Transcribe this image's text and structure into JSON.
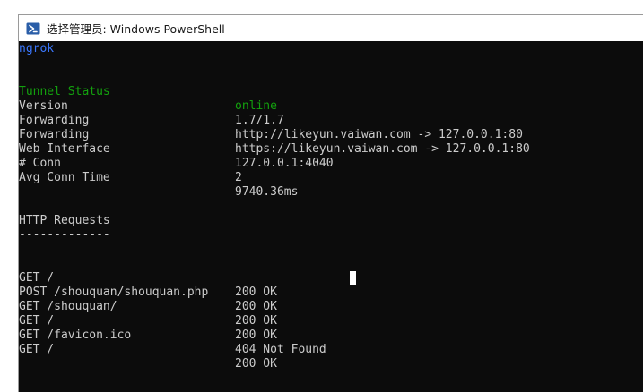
{
  "window": {
    "title": "选择管理员: Windows PowerShell",
    "icon": "powershell-icon"
  },
  "console": {
    "brand": "ngrok",
    "status": [
      {
        "label": "Tunnel Status",
        "value": "online"
      },
      {
        "label": "Version",
        "value": "1.7/1.7"
      },
      {
        "label": "Forwarding",
        "value": "http://likeyun.vaiwan.com -> 127.0.0.1:80"
      },
      {
        "label": "Forwarding",
        "value": "https://likeyun.vaiwan.com -> 127.0.0.1:80"
      },
      {
        "label": "Web Interface",
        "value": "127.0.0.1:4040"
      },
      {
        "label": "# Conn",
        "value": "2"
      },
      {
        "label": "Avg Conn Time",
        "value": "9740.36ms"
      }
    ],
    "requests_heading": "HTTP Requests",
    "requests_divider": "-------------",
    "requests": [
      {
        "request": "GET /",
        "status": "200 OK"
      },
      {
        "request": "POST /shouquan/shouquan.php",
        "status": "200 OK"
      },
      {
        "request": "GET /shouquan/",
        "status": "200 OK"
      },
      {
        "request": "GET /",
        "status": "200 OK"
      },
      {
        "request": "GET /favicon.ico",
        "status": "404 Not Found"
      },
      {
        "request": "GET /",
        "status": "200 OK"
      }
    ]
  },
  "colors": {
    "background": "#0c0c0c",
    "text": "#cccccc",
    "brand": "#3b78ff",
    "online": "#13a10e"
  }
}
